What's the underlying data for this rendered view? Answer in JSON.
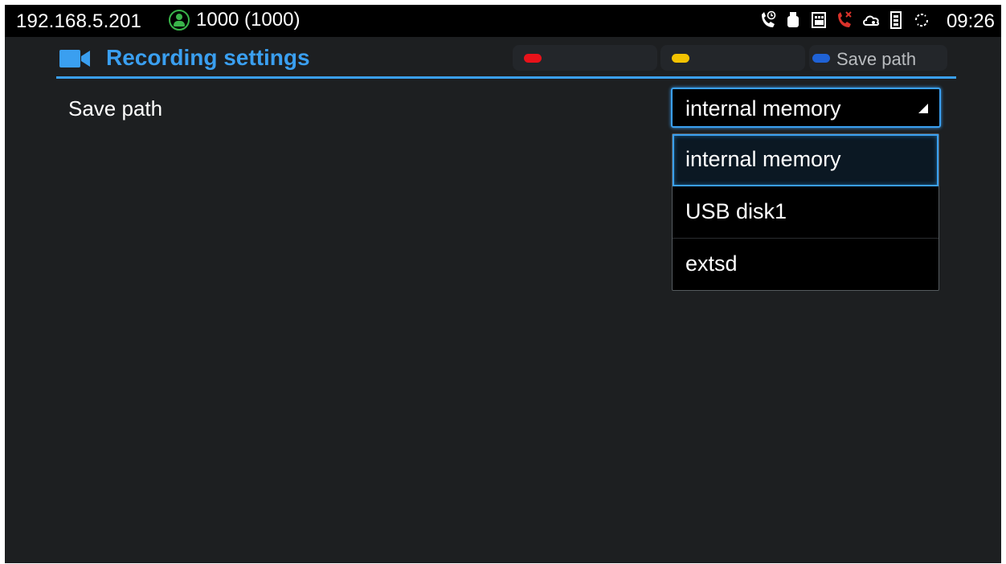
{
  "status_bar": {
    "ip": "192.168.5.201",
    "account": "1000 (1000)",
    "account_icon": "account-registered-icon",
    "icons": [
      "call-forward-icon",
      "usb-icon",
      "sd-card-icon",
      "missed-call-icon",
      "cloud-icon",
      "memory-icon",
      "sync-icon"
    ],
    "time": "09:26"
  },
  "header": {
    "icon": "video-camera-icon",
    "title": "Recording settings"
  },
  "softkeys": [
    {
      "color": "#e8121a",
      "label": ""
    },
    {
      "color": "#f2c200",
      "label": ""
    },
    {
      "color": "#1f62d6",
      "label": "Save path"
    }
  ],
  "setting": {
    "label": "Save path",
    "selected_value": "internal memory"
  },
  "dropdown": {
    "options": [
      "internal memory",
      "USB disk1",
      "extsd"
    ],
    "selected_index": 0
  },
  "colors": {
    "accent": "#3a9ff0",
    "background": "#1d1f21",
    "status_bar": "#000000",
    "account_ok": "#39b54a",
    "alert": "#d9322a"
  }
}
